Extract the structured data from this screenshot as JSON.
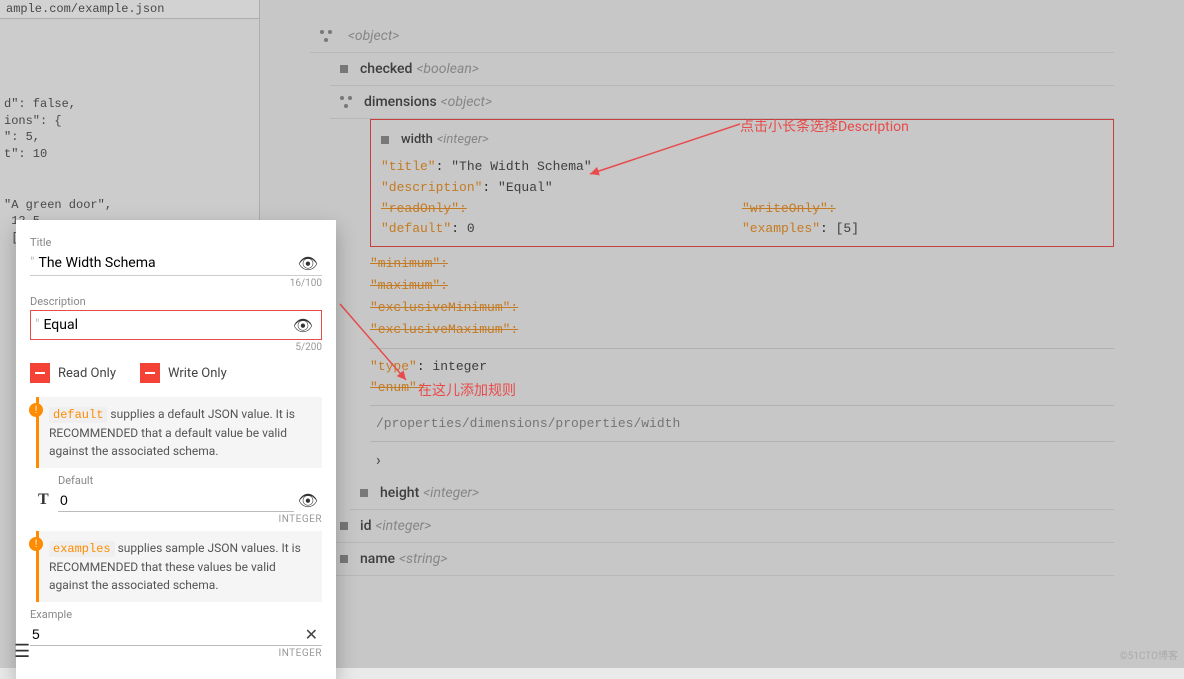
{
  "url": "ample.com/example.json",
  "code_snippet": "\nd\": false,\nions\": {\n\": 5,\nt\": 10\n\n\n\"A green door\",\n 12.5,\n [",
  "tree": {
    "root_object": "<object>",
    "checked": {
      "name": "checked",
      "type": "<boolean>"
    },
    "dimensions": {
      "name": "dimensions",
      "type": "<object>"
    },
    "width": {
      "name": "width",
      "type": "<integer>"
    },
    "height": {
      "name": "height",
      "type": "<integer>"
    },
    "id": {
      "name": "id",
      "type": "<integer>"
    },
    "name": {
      "name": "name",
      "type": "<string>"
    }
  },
  "width_schema": {
    "title_kv": {
      "key": "\"title\"",
      "val": "\"The Width Schema\""
    },
    "desc_kv": {
      "key": "\"description\"",
      "val": "\"Equal\""
    },
    "readOnly": "\"readOnly\":",
    "writeOnly": "\"writeOnly\":",
    "default_kv": {
      "key": "\"default\"",
      "val": "0"
    },
    "examples_kv": {
      "key": "\"examples\"",
      "val": "[5]"
    },
    "constraints": [
      "\"minimum\":",
      "\"maximum\":",
      "\"exclusiveMinimum\":",
      "\"exclusiveMaximum\":"
    ],
    "type_kv": {
      "key": "\"type\"",
      "val": "integer"
    },
    "enum": "\"enum\":",
    "path": "/properties/dimensions/properties/width"
  },
  "annotations": {
    "desc_hint": "点击小长条选择Description",
    "rule_hint": "在这儿添加规则"
  },
  "card": {
    "title_label": "Title",
    "title_value": "The Width Schema",
    "title_counter": "16/100",
    "desc_label": "Description",
    "desc_value": "Equal",
    "desc_counter": "5/200",
    "read_only": "Read Only",
    "write_only": "Write Only",
    "default_info_key": "default",
    "default_info": " supplies a default JSON value. It is RECOMMENDED that a default value be valid against the associated schema.",
    "default_label": "Default",
    "default_value": "0",
    "type_hint": "INTEGER",
    "examples_info_key": "examples",
    "examples_info": " supplies sample JSON values. It is RECOMMENDED that these values be valid against the associated schema.",
    "example_label": "Example",
    "example_value": "5"
  },
  "watermark": "©51CTO博客"
}
